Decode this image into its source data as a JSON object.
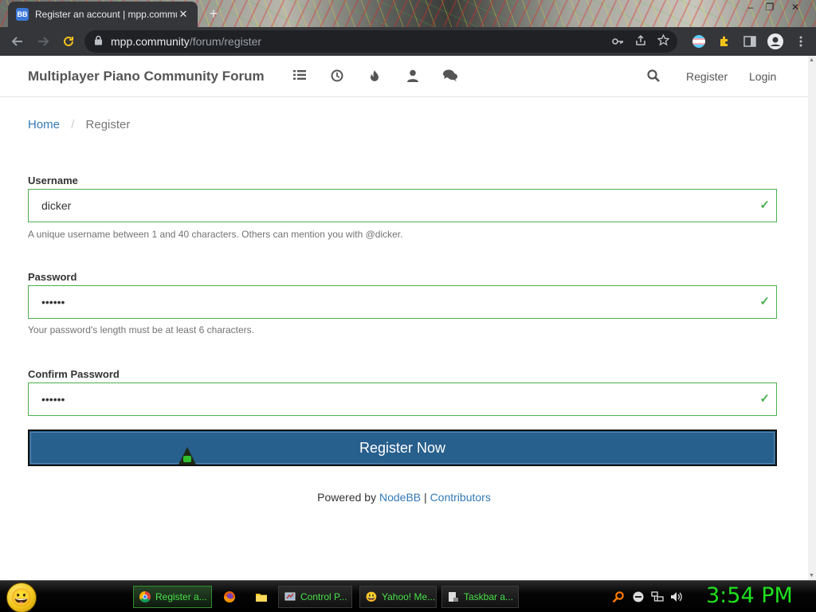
{
  "browser": {
    "tab_title": "Register an account | mpp.community",
    "tab_favicon": "BB",
    "new_tab": "+",
    "tab_close": "✕",
    "window_controls": [
      "–",
      "❐",
      "✕"
    ],
    "url_host": "mpp.community",
    "url_path": "/forum/register"
  },
  "site": {
    "brand": "Multiplayer Piano Community Forum",
    "nav_register": "Register",
    "nav_login": "Login"
  },
  "breadcrumb": {
    "home": "Home",
    "separator": "/",
    "current": "Register"
  },
  "form": {
    "username": {
      "label": "Username",
      "value": "dicker",
      "help": "A unique username between 1 and 40 characters. Others can mention you with @dicker."
    },
    "password": {
      "label": "Password",
      "value": "••••••",
      "help": "Your password's length must be at least 6 characters."
    },
    "confirm_password": {
      "label": "Confirm Password",
      "value": "••••••"
    },
    "submit_label": "Register Now"
  },
  "footer": {
    "powered_by": "Powered by",
    "nodebb": "NodeBB",
    "separator": "|",
    "contributors": "Contributors"
  },
  "taskbar": {
    "tasks": [
      {
        "label": "Register a...",
        "icon": "chrome-icon"
      },
      {
        "label": "Control P...",
        "icon": "control-panel-icon"
      },
      {
        "label": "Yahoo! Me...",
        "icon": "yahoo-messenger-icon"
      },
      {
        "label": "Taskbar a...",
        "icon": "taskbar-app-icon"
      }
    ],
    "clock": "3:54 PM"
  },
  "colors": {
    "valid_border": "#4caf50",
    "button_bg": "#275f8d",
    "link": "#337ab7",
    "clock": "#1fe01f"
  }
}
